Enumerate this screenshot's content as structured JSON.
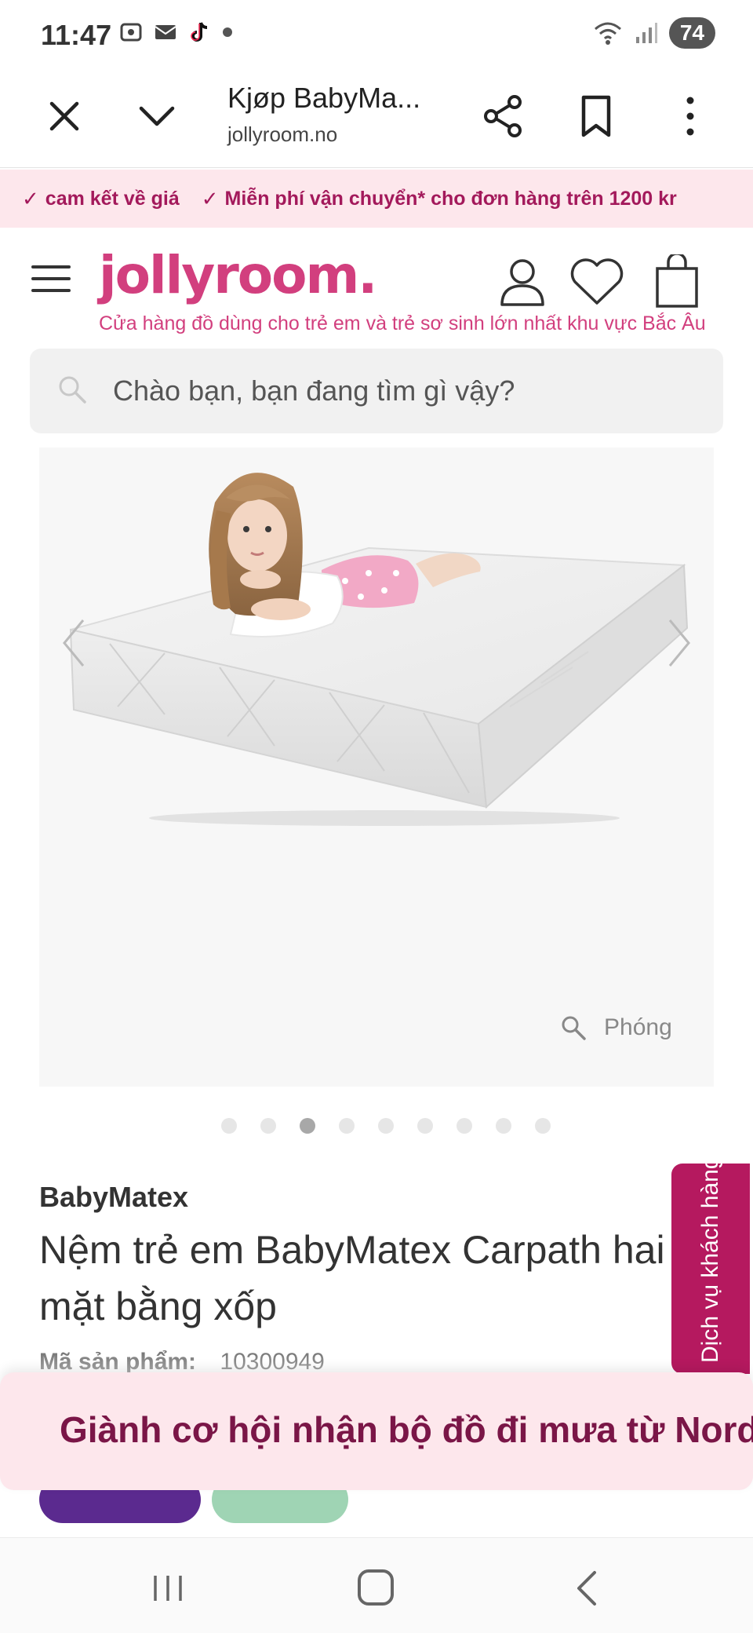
{
  "status_bar": {
    "time": "11:47",
    "battery": "74",
    "icons": [
      "screenshot-icon",
      "mail-icon",
      "tiktok-icon",
      "dot-icon",
      "wifi-icon",
      "signal-icon"
    ]
  },
  "browser": {
    "tab_title": "Kjøp BabyMa...",
    "url": "jollyroom.no"
  },
  "promo": {
    "item1": "cam kết về giá",
    "item2": "Miễn phí vận chuyển* cho đơn hàng trên 1200 kr",
    "check": "✓"
  },
  "site": {
    "logo": "jollyroom.",
    "tagline": "Cửa hàng đồ dùng cho trẻ em và trẻ sơ sinh lớn nhất khu vực Bắc Âu",
    "brand_color": "#d23f7e"
  },
  "search": {
    "placeholder": "Chào bạn, bạn đang tìm gì vậy?"
  },
  "gallery": {
    "zoom_label": "Phóng",
    "total_images": 9,
    "active_index": 2
  },
  "product": {
    "brand": "BabyMatex",
    "title": "Nệm trẻ em BabyMatex Carpath hai mặt bằng xốp",
    "sku_label": "Mã sản phẩm:",
    "sku": "10300949"
  },
  "customer_service": {
    "label": "Dịch vụ khách hàng"
  },
  "banner": {
    "text": "Giành cơ hội nhận bộ đồ đi mưa từ Nordic"
  }
}
